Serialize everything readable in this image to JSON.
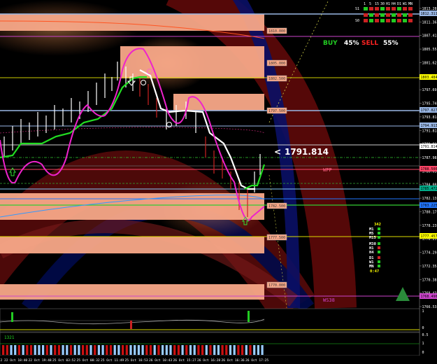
{
  "signal": {
    "buy_label": "BUY",
    "buy_pct": "45%",
    "sell_label": "SELL",
    "sell_pct": "55%",
    "buy_color": "#22cc22",
    "sell_color": "#ff2222"
  },
  "current_price": {
    "marker": "<",
    "value": "1791.814"
  },
  "mtf_header": {
    "timeframes": [
      "1",
      "5",
      "15",
      "30",
      "H1",
      "H4",
      "D1",
      "W1",
      "MN"
    ],
    "rows": [
      "S1",
      "S0"
    ]
  },
  "level_boxes": [
    {
      "label": "1810.000"
    },
    {
      "label": "1805.000"
    },
    {
      "label": "1802.500"
    },
    {
      "label": "1797.500"
    },
    {
      "label": "1782.500"
    },
    {
      "label": "1777.500"
    },
    {
      "label": "1770.000"
    }
  ],
  "line_labels": {
    "wpp": "WPP",
    "ws38": "WS38"
  },
  "price_axis": {
    "ticks": [
      "1813.285",
      "1811.360",
      "1807.415",
      "1805.550",
      "1801.625",
      "1799.655",
      "1797.690",
      "1795.740",
      "1793.815",
      "1791.814",
      "1789.910",
      "1787.985",
      "1786.035",
      "1784.080",
      "1782.135",
      "1780.175",
      "1778.230",
      "1776.255",
      "1774.295",
      "1772.350",
      "1770.380",
      "1768.435",
      "1766.535"
    ],
    "highlights": [
      {
        "label": "1812.311",
        "color": "#9ab8e6"
      },
      {
        "label": "1803.484",
        "color": "#ffff00"
      },
      {
        "label": "1797.827",
        "color": "#9ab8e6"
      },
      {
        "label": "1794.913",
        "color": "#9ab8e6"
      },
      {
        "label": "1788.500",
        "color": "#ff4466"
      },
      {
        "label": "1785.472",
        "color": "#00aa88"
      },
      {
        "label": "1783.225",
        "color": "#2277ff"
      },
      {
        "label": "1777.457",
        "color": "#ffff00"
      },
      {
        "label": "1768.496",
        "color": "#cc44cc"
      }
    ]
  },
  "side_panel": {
    "count": "342",
    "labels_top": [
      "M1",
      "M5",
      "M15"
    ],
    "labels_mid": [
      "M30",
      "H1",
      "H4"
    ],
    "labels_bot": [
      "D1",
      "W1",
      "MN"
    ],
    "timer": "0:47"
  },
  "sub_panel": {
    "value": "1321",
    "axis": [
      "1",
      "0",
      "0.5",
      "1",
      "0"
    ]
  },
  "time_axis": {
    "labels": [
      "2",
      "22 Oct 18:40",
      "22 Oct 19:48",
      "25 Oct 03:52",
      "25 Oct 08:32",
      "25 Oct 11:49",
      "25 Oct 16:53",
      "26 Oct 10:43",
      "26 Oct 15:27",
      "26 Oct 16:28",
      "26 Oct 16:36",
      "26 Oct 17:25"
    ]
  }
}
